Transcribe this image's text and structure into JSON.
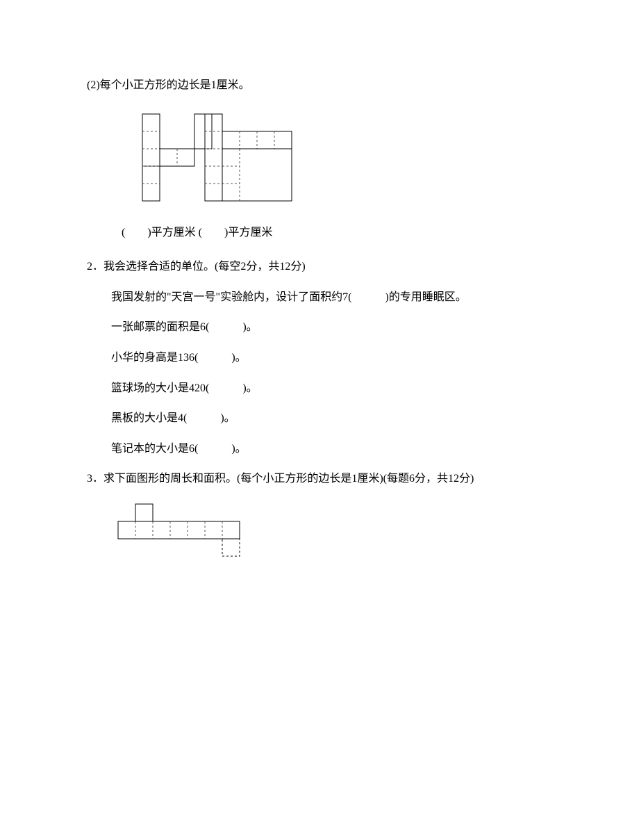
{
  "q1_sub2_intro": "(2)每个小正方形的边长是1厘米。",
  "caption_blank_left": "(　　)平方厘米",
  "caption_blank_right": "(　　)平方厘米",
  "q2_heading": "2．我会选择合适的单位。(每空2分，共12分)",
  "q2_items": [
    "我国发射的\"天宫一号\"实验舱内，设计了面积约7(　　　)的专用睡眠区。",
    "一张邮票的面积是6(　　　)。",
    "小华的身高是136(　　　)。",
    "篮球场的大小是420(　　　)。",
    "黑板的大小是4(　　　)。",
    "笔记本的大小是6(　　　)。"
  ],
  "q3_heading": "3．求下面图形的周长和面积。(每个小正方形的边长是1厘米)(每题6分，共12分)"
}
